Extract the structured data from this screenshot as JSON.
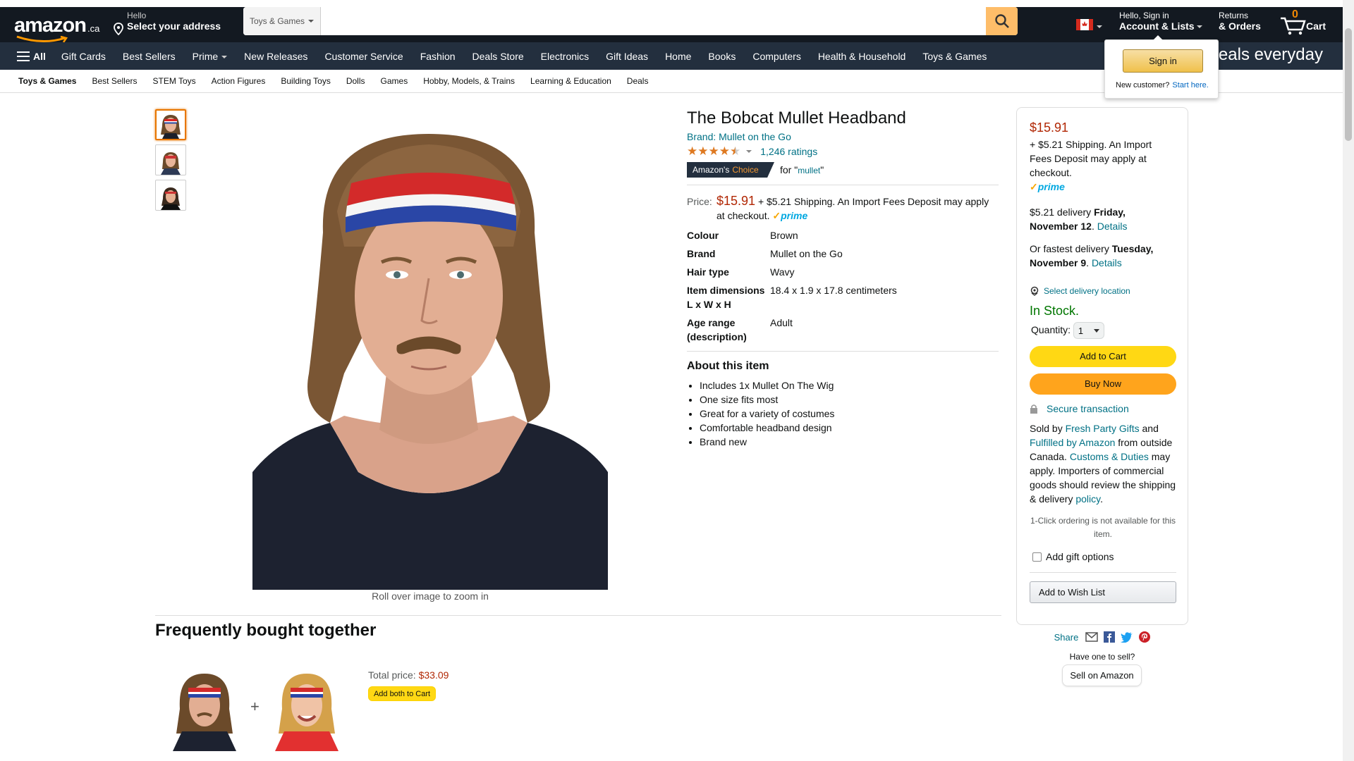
{
  "header": {
    "logo_text": "amazon",
    "logo_suffix": ".ca",
    "address_line1": "Hello",
    "address_line2": "Select your address",
    "search_category": "Toys & Games",
    "search_placeholder": "",
    "account_line1": "Hello, Sign in",
    "account_line2": "Account & Lists",
    "returns_line1": "Returns",
    "returns_line2": "& Orders",
    "cart_count": "0",
    "cart_label": "Cart"
  },
  "nav": {
    "all_label": "All",
    "links": [
      "Gift Cards",
      "Best Sellers",
      "Prime",
      "New Releases",
      "Customer Service",
      "Fashion",
      "Deals Store",
      "Electronics",
      "Gift Ideas",
      "Home",
      "Books",
      "Computers",
      "Health & Household",
      "Toys & Games"
    ],
    "promo": "deals everyday"
  },
  "signin_flyout": {
    "button": "Sign in",
    "new_customer": "New customer?",
    "start_here": "Start here."
  },
  "subnav": [
    "Toys & Games",
    "Best Sellers",
    "STEM Toys",
    "Action Figures",
    "Building Toys",
    "Dolls",
    "Games",
    "Hobby, Models, & Trains",
    "Learning & Education",
    "Deals"
  ],
  "gallery": {
    "roll_over": "Roll over image to zoom in"
  },
  "product": {
    "title": "The Bobcat Mullet Headband",
    "brand_link": "Brand: Mullet on the Go",
    "rating": 4.5,
    "ratings_count": "1,246 ratings",
    "choice_label": "Amazon's",
    "choice_highlight": "Choice",
    "choice_for": "for \"",
    "choice_term": "mullet",
    "choice_end": "\"",
    "price_label": "Price:",
    "price": "$15.91",
    "price_note": "+ $5.21 Shipping. An Import Fees Deposit may apply at checkout.",
    "prime": "prime",
    "specs": [
      {
        "key": "Colour",
        "value": "Brown"
      },
      {
        "key": "Brand",
        "value": "Mullet on the Go"
      },
      {
        "key": "Hair type",
        "value": "Wavy"
      },
      {
        "key": "Item dimensions L x W x H",
        "value": "18.4 x 1.9 x 17.8 centimeters"
      },
      {
        "key": "Age range (description)",
        "value": "Adult"
      }
    ],
    "about_title": "About this item",
    "about_items": [
      "Includes 1x Mullet On The Wig",
      "One size fits most",
      "Great for a variety of costumes",
      "Comfortable headband design",
      "Brand new"
    ]
  },
  "buybox": {
    "price": "$15.91",
    "shipping": "+ $5.21 Shipping. An Import Fees Deposit may apply at checkout.",
    "delivery_prefix": "$5.21 delivery",
    "delivery_date": "Friday, November 12",
    "details": "Details",
    "fastest_prefix": "Or fastest delivery",
    "fastest_date": "Tuesday, November 9",
    "location": "Select delivery location",
    "stock": "In Stock.",
    "quantity_label": "Quantity:",
    "quantity": "1",
    "add_to_cart": "Add to Cart",
    "buy_now": "Buy Now",
    "secure": "Secure transaction",
    "sold_by_prefix": "Sold by",
    "seller": "Fresh Party Gifts",
    "and": "and",
    "fulfilled": "Fulfilled by Amazon",
    "from_outside": "from outside Canada.",
    "customs": "Customs & Duties",
    "customs_rest": "may apply. Importers of commercial goods should review the shipping & delivery",
    "policy": "policy",
    "oneclick": "1-Click ordering is not available for this item.",
    "gift": "Add gift options",
    "wishlist": "Add to Wish List",
    "share": "Share",
    "have_one": "Have one to sell?",
    "sell": "Sell on Amazon"
  },
  "fbt": {
    "title": "Frequently bought together",
    "plus": "+",
    "total_label": "Total price:",
    "total": "$33.09",
    "add_both": "Add both to Cart"
  },
  "colors": {
    "nav_dark": "#131921",
    "nav_main": "#232f3e",
    "search_button": "#febd69",
    "price_red": "#b12704",
    "link": "#007185",
    "in_stock": "#007600",
    "add_cart": "#ffd814",
    "buy_now": "#ffa41c"
  }
}
